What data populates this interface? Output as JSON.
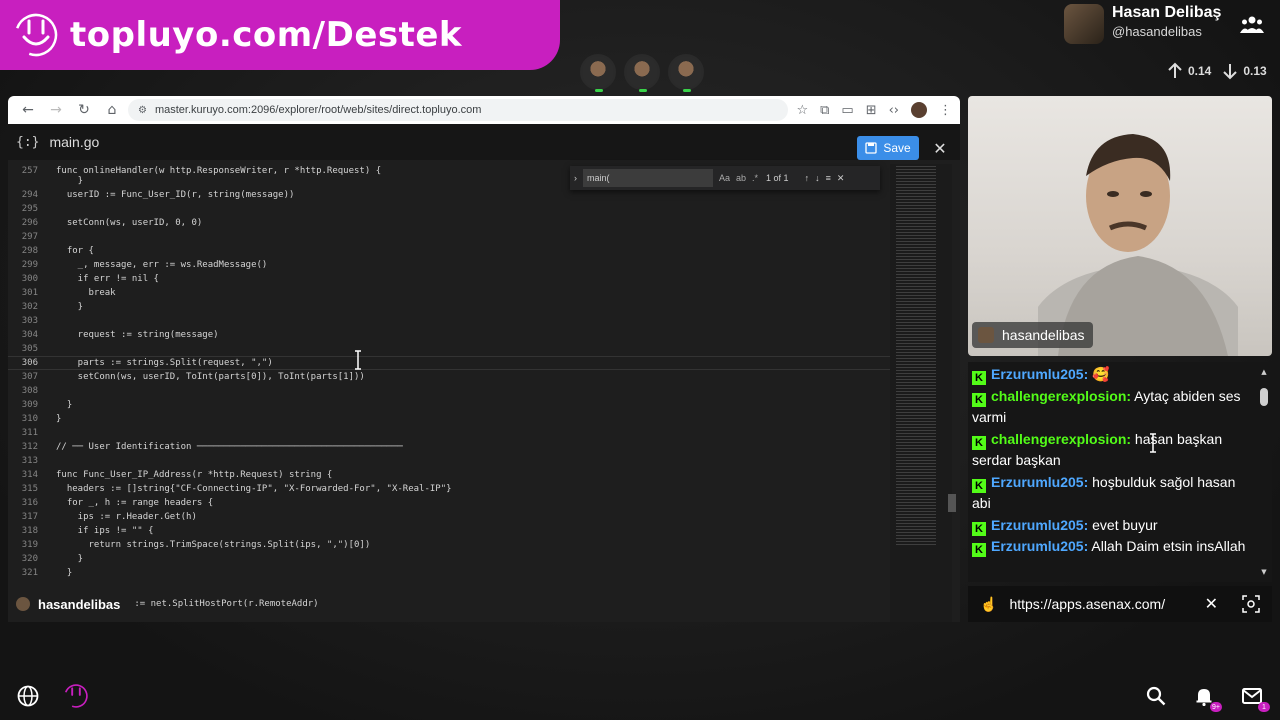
{
  "banner": {
    "text": "topluyo.com/Destek"
  },
  "profile": {
    "name": "Hasan Delibaş",
    "handle": "@hasandelibas"
  },
  "stats": {
    "up": "0.14",
    "down": "0.13"
  },
  "browser": {
    "url": "master.kuruyo.com:2096/explorer/root/web/sites/direct.topluyo.com"
  },
  "editor": {
    "file_icon": "{:}",
    "file_name": "main.go",
    "save_label": "Save",
    "find": {
      "query": "main(",
      "count": "1 of 1",
      "opt_case": "Aa",
      "opt_word": "ab",
      "opt_regex": ".*"
    },
    "lines": [
      {
        "n": "257",
        "text": "func onlineHandler(w http.ResponseWriter, r *http.Request) {"
      },
      {
        "n": "",
        "text": "    }"
      },
      {
        "n": "294",
        "text": "  userID := Func_User_ID(r, string(message))"
      },
      {
        "n": "295",
        "text": ""
      },
      {
        "n": "296",
        "text": "  setConn(ws, userID, 0, 0)"
      },
      {
        "n": "297",
        "text": ""
      },
      {
        "n": "298",
        "text": "  for {"
      },
      {
        "n": "299",
        "text": "    _, message, err := ws.ReadMessage()"
      },
      {
        "n": "300",
        "text": "    if err != nil {"
      },
      {
        "n": "301",
        "text": "      break"
      },
      {
        "n": "302",
        "text": "    }"
      },
      {
        "n": "303",
        "text": ""
      },
      {
        "n": "304",
        "text": "    request := string(message)"
      },
      {
        "n": "305",
        "text": ""
      },
      {
        "n": "306",
        "text": "    parts := strings.Split(request, \",\")"
      },
      {
        "n": "307",
        "text": "    setConn(ws, userID, ToInt(parts[0]), ToInt(parts[1]))"
      },
      {
        "n": "308",
        "text": ""
      },
      {
        "n": "309",
        "text": "  }"
      },
      {
        "n": "310",
        "text": "}"
      },
      {
        "n": "311",
        "text": ""
      },
      {
        "n": "312",
        "text": "// ── User Identification ──────────────────────────────────────"
      },
      {
        "n": "313",
        "text": ""
      },
      {
        "n": "314",
        "text": "func Func_User_IP_Address(r *http.Request) string {"
      },
      {
        "n": "315",
        "text": "  headers := []string{\"CF-Connecting-IP\", \"X-Forwarded-For\", \"X-Real-IP\"}"
      },
      {
        "n": "316",
        "text": "  for _, h := range headers {"
      },
      {
        "n": "317",
        "text": "    ips := r.Header.Get(h)"
      },
      {
        "n": "318",
        "text": "    if ips != \"\" {"
      },
      {
        "n": "319",
        "text": "      return strings.TrimSpace(strings.Split(ips, \",\")[0])"
      },
      {
        "n": "320",
        "text": "    }"
      },
      {
        "n": "321",
        "text": "  }"
      }
    ],
    "status_user": "hasandelibas",
    "status_code": ":= net.SplitHostPort(r.RemoteAddr)"
  },
  "cam": {
    "label": "hasandelibas"
  },
  "chat": {
    "messages": [
      {
        "user": "Erzurumlu205:",
        "text": " 🥰",
        "style": "a"
      },
      {
        "user": "challengerexplosion:",
        "text": " Aytaç abiden ses varmi",
        "style": "b"
      },
      {
        "user": "challengerexplosion:",
        "text": " hasan başkan serdar başkan",
        "style": "b"
      },
      {
        "user": "Erzurumlu205:",
        "text": " hoşbulduk sağol hasan abi",
        "style": "a"
      },
      {
        "user": "Erzurumlu205:",
        "text": " evet buyur",
        "style": "a"
      },
      {
        "user": "Erzurumlu205:",
        "text": " Allah Daim etsin insAllah",
        "style": "a"
      }
    ],
    "kick_glyph": "K"
  },
  "urlbar": {
    "url": "https://apps.asenax.com/"
  },
  "bottom": {
    "notif_badge": "9+",
    "mail_badge": "1"
  },
  "colors": {
    "brand": "#c81fbf",
    "kick": "#53fc18",
    "save": "#3b8ee8",
    "user_blue": "#4fa8ff"
  }
}
